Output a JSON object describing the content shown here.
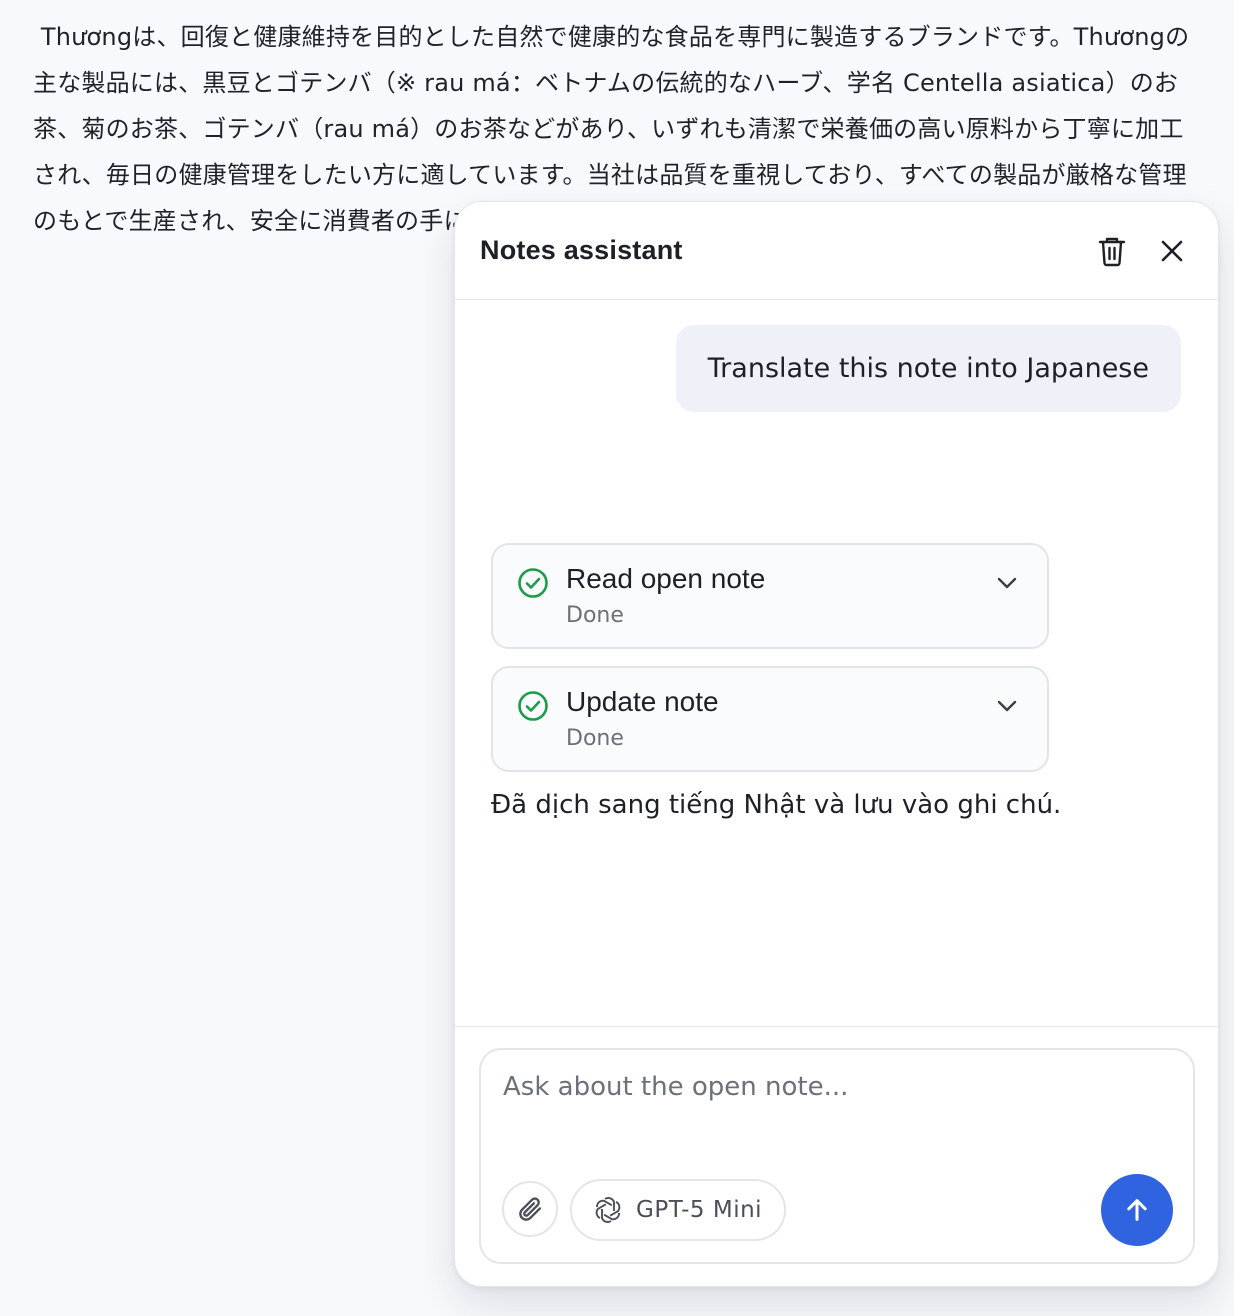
{
  "note": {
    "text": " Thươngは、回復と健康維持を目的とした自然で健康的な食品を専門に製造するブランドです。Thươngの主な製品には、黒豆とゴテンバ（※ rau má：ベトナムの伝統的なハーブ、学名 Centella asiatica）のお茶、菊のお茶、ゴテンバ（rau má）のお茶などがあり、いずれも清潔で栄養価の高い原料から丁寧に加工され、毎日の健康管理をしたい方に適しています。当社は品質を重視しており、すべての製品が厳格な管理のもとで生産され、安全に消費者の手に届きます。"
  },
  "assistant": {
    "title": "Notes assistant",
    "delete_icon": "trash-icon",
    "close_icon": "close-icon",
    "user_message": "Translate this note into Japanese",
    "tools": [
      {
        "title": "Read open note",
        "status": "Done",
        "icon": "check-circle-icon"
      },
      {
        "title": "Update note",
        "status": "Done",
        "icon": "check-circle-icon"
      }
    ],
    "reply": "Đã dịch sang tiếng Nhật và lưu vào ghi chú.",
    "composer": {
      "placeholder": "Ask about the open note...",
      "value": "",
      "model_label": "GPT-5 Mini",
      "attach_icon": "paperclip-icon",
      "model_icon": "openai-icon",
      "send_icon": "arrow-up-icon"
    }
  },
  "colors": {
    "accent": "#2f63e0",
    "success": "#1e9a4a",
    "bubble": "#eff1f8"
  }
}
